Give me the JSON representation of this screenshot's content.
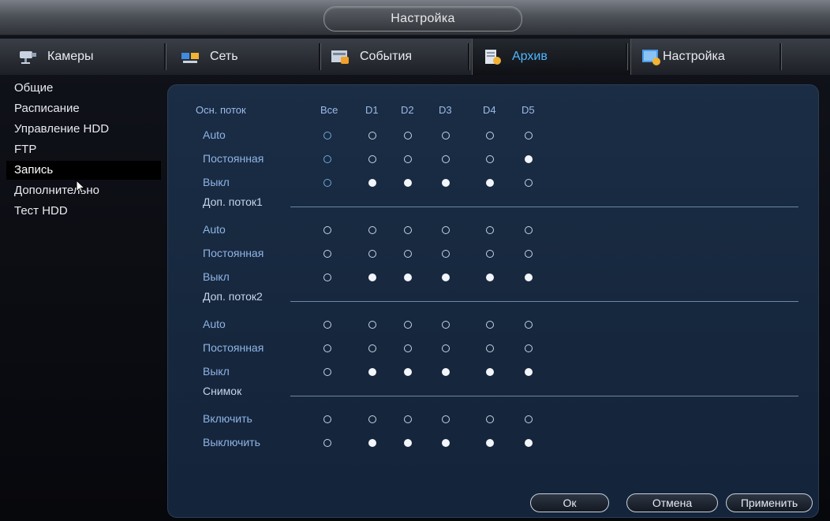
{
  "window": {
    "title": "Настройка"
  },
  "tabs": [
    {
      "label": "Камеры",
      "icon": "camera-icon"
    },
    {
      "label": "Сеть",
      "icon": "network-icon"
    },
    {
      "label": "События",
      "icon": "events-icon"
    },
    {
      "label": "Архив",
      "icon": "archive-icon",
      "active": true
    },
    {
      "label": "Настройка",
      "icon": "settings-icon"
    }
  ],
  "sidebar": {
    "items": [
      {
        "label": "Общие"
      },
      {
        "label": "Расписание"
      },
      {
        "label": "Управление HDD"
      },
      {
        "label": "FTP"
      },
      {
        "label": "Запись",
        "active": true
      },
      {
        "label": "Дополнительно"
      },
      {
        "label": "Тест HDD"
      }
    ]
  },
  "record": {
    "header_main": "Осн. поток",
    "columns": [
      "Все",
      "D1",
      "D2",
      "D3",
      "D4",
      "D5"
    ],
    "sections": [
      {
        "title": "",
        "rows": [
          {
            "label": "Auto",
            "values": [
              false,
              false,
              false,
              false,
              false,
              false
            ]
          },
          {
            "label": "Постоянная",
            "values": [
              false,
              false,
              false,
              false,
              false,
              true
            ]
          },
          {
            "label": "Выкл",
            "values": [
              false,
              true,
              true,
              true,
              true,
              false
            ]
          }
        ]
      },
      {
        "title": "Доп. поток1",
        "rows": [
          {
            "label": "Auto",
            "values": [
              false,
              false,
              false,
              false,
              false,
              false
            ]
          },
          {
            "label": "Постоянная",
            "values": [
              false,
              false,
              false,
              false,
              false,
              false
            ]
          },
          {
            "label": "Выкл",
            "values": [
              false,
              true,
              true,
              true,
              true,
              true
            ]
          }
        ]
      },
      {
        "title": "Доп. поток2",
        "rows": [
          {
            "label": "Auto",
            "values": [
              false,
              false,
              false,
              false,
              false,
              false
            ]
          },
          {
            "label": "Постоянная",
            "values": [
              false,
              false,
              false,
              false,
              false,
              false
            ]
          },
          {
            "label": "Выкл",
            "values": [
              false,
              true,
              true,
              true,
              true,
              true
            ]
          }
        ]
      },
      {
        "title": "Снимок",
        "rows": [
          {
            "label": "Включить",
            "values": [
              false,
              false,
              false,
              false,
              false,
              false
            ]
          },
          {
            "label": "Выключить",
            "values": [
              false,
              true,
              true,
              true,
              true,
              true
            ]
          }
        ]
      }
    ]
  },
  "buttons": {
    "ok": "Ок",
    "cancel": "Отмена",
    "apply": "Применить"
  },
  "colors": {
    "accent": "#4fb6ff",
    "panel": "#1a2d45",
    "row_text": "#8fb4e6"
  }
}
